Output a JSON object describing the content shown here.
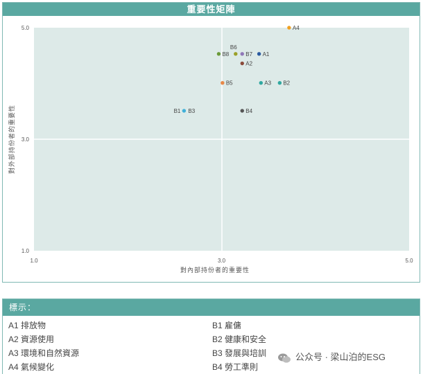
{
  "title": "重要性矩陣",
  "chart_data": {
    "type": "scatter",
    "xlabel": "對內部持份者的重要性",
    "ylabel": "對外部持份者的重要性",
    "xlim": [
      1.0,
      5.0
    ],
    "ylim": [
      1.0,
      5.0
    ],
    "xticks": [
      "1.0",
      "3.0",
      "5.0"
    ],
    "yticks": [
      "1.0",
      "3.0",
      "5.0"
    ],
    "grid": false,
    "quadrant_lines_at": {
      "x": 3.0,
      "y": 3.0
    },
    "points": [
      {
        "label": "A4",
        "x": 3.72,
        "y": 5.0,
        "color": "#f0a020"
      },
      {
        "label": "B6",
        "x": 3.15,
        "y": 4.53,
        "color": "#9aa028"
      },
      {
        "label": "B8",
        "x": 2.97,
        "y": 4.53,
        "color": "#6a9a38"
      },
      {
        "label": "B7",
        "x": 3.22,
        "y": 4.53,
        "color": "#9078b8"
      },
      {
        "label": "A1",
        "x": 3.4,
        "y": 4.53,
        "color": "#2a5aa0"
      },
      {
        "label": "A2",
        "x": 3.22,
        "y": 4.36,
        "color": "#8b4a3a"
      },
      {
        "label": "B5",
        "x": 3.01,
        "y": 4.01,
        "color": "#e88848"
      },
      {
        "label": "A3",
        "x": 3.42,
        "y": 4.01,
        "color": "#30a8a0"
      },
      {
        "label": "B2",
        "x": 3.62,
        "y": 4.01,
        "color": "#30a8a0"
      },
      {
        "label": "B1",
        "x": 2.6,
        "y": 3.51,
        "color": "#40b0d8"
      },
      {
        "label": "B4",
        "x": 3.22,
        "y": 3.51,
        "color": "#555555"
      }
    ]
  },
  "legend": {
    "heading": "標示：",
    "col_a": [
      "A1 排放物",
      "A2 資源使用",
      "A3 環境和自然資源",
      "A4 氣候變化"
    ],
    "col_b": [
      "B1 雇傭",
      "B2 健康和安全",
      "B3 發展與培訓",
      "B4 勞工準則"
    ]
  },
  "watermark": "公众号 · 梁山泊的ESG"
}
